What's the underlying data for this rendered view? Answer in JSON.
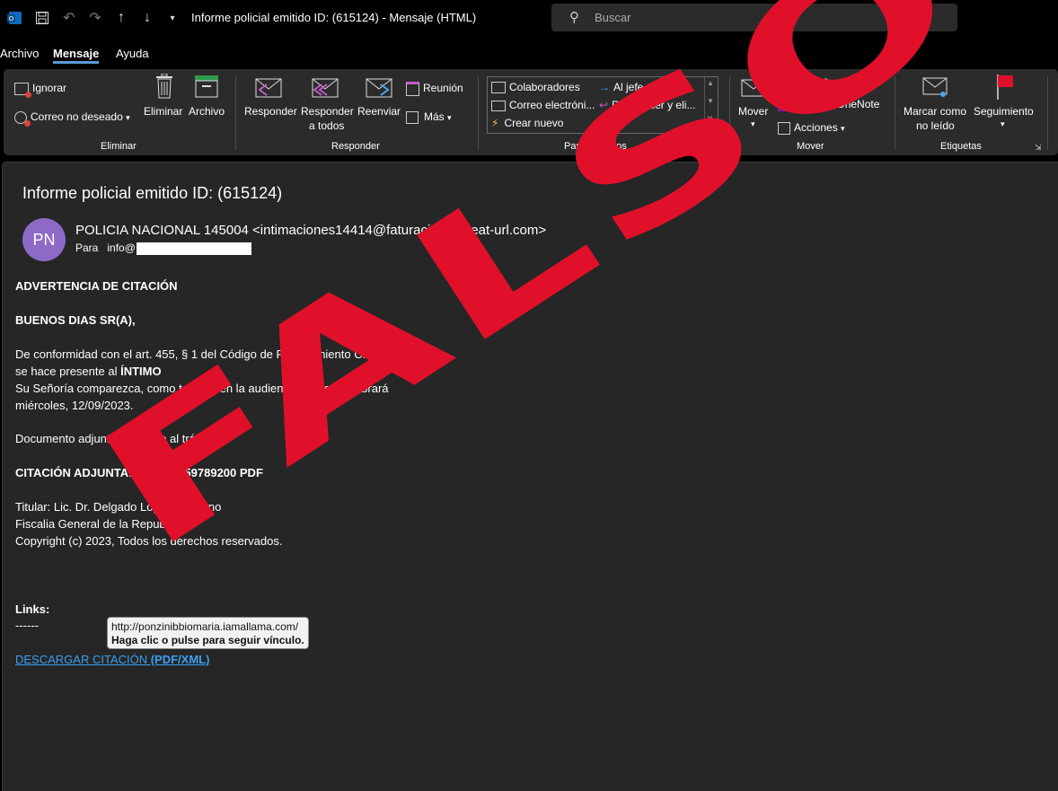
{
  "window": {
    "title": "Informe policial emitido ID: (615124)  -  Mensaje (HTML)",
    "search_placeholder": "Buscar"
  },
  "menu": {
    "tabs": [
      {
        "label": "Archivo",
        "active": false
      },
      {
        "label": "Mensaje",
        "active": true
      },
      {
        "label": "Ayuda",
        "active": false
      }
    ]
  },
  "ribbon": {
    "eliminar": {
      "ignorar": "Ignorar",
      "correo_no_deseado": "Correo no deseado",
      "eliminar": "Eliminar",
      "archivo": "Archivo",
      "group": "Eliminar"
    },
    "responder": {
      "responder": "Responder",
      "responder_todos_1": "Responder",
      "responder_todos_2": "a todos",
      "reenviar": "Reenviar",
      "reunion": "Reunión",
      "mas": "Más",
      "group": "Responder"
    },
    "pasos": {
      "colaboradores": "Colaboradores",
      "al_jefe": "Al jefe",
      "correo_electronico": "Correo electróni...",
      "responder_eliminar": "Responder y eli...",
      "crear_nuevo": "Crear nuevo",
      "group": "Pasos rápidos"
    },
    "mover": {
      "mover": "Mover",
      "reglas": "Reglas",
      "onenote": "Enviar a OneNote",
      "acciones": "Acciones",
      "group": "Mover"
    },
    "etiquetas": {
      "marcar_1": "Marcar como",
      "marcar_2": "no leído",
      "seguimiento": "Seguimiento",
      "group": "Etiquetas"
    }
  },
  "message": {
    "subject": "Informe policial emitido ID: (615124)",
    "avatar_initials": "PN",
    "sender": "POLICIA NACIONAL 145004 <intimaciones14414@faturaciones.neat-url.com>",
    "to_label": "Para",
    "to_value": "info@",
    "body": {
      "l1": "ADVERTENCIA DE CITACIÓN",
      "l2": "BUENOS DIAS SR(A),",
      "l3": "De conformidad con el art. 455, § 1 del Código de Procedimiento Civil",
      "l4a": "se hace presente al ",
      "l4b": "ÍNTIMO",
      "l5": "Su Señoría comparezca, como testigo, en la audiencia que se celebrará",
      "l6": "miércoles, 12/09/2023.",
      "l7": "Documento adjunto referente al trámite",
      "l8": "CITACIÓN ADJUNTA: N° 1624559789200 PDF",
      "l9": "Titular: Lic. Dr. Delgado López Medrano",
      "l10": "Fiscalia General de la Republica",
      "l11": "Copyright (c) 2023, Todos los derechos reservados.",
      "l12": "Links:",
      "l13": "------"
    },
    "link_a": "DESCARGAR CITACIÓN ",
    "link_b": "(PDF/XML)",
    "tooltip_url": "http://ponzinibbiomaria.iamallama.com/",
    "tooltip_hint": "Haga clic o pulse para seguir vínculo."
  },
  "stamp": {
    "text": "FALSO",
    "color": "#e0102a"
  }
}
